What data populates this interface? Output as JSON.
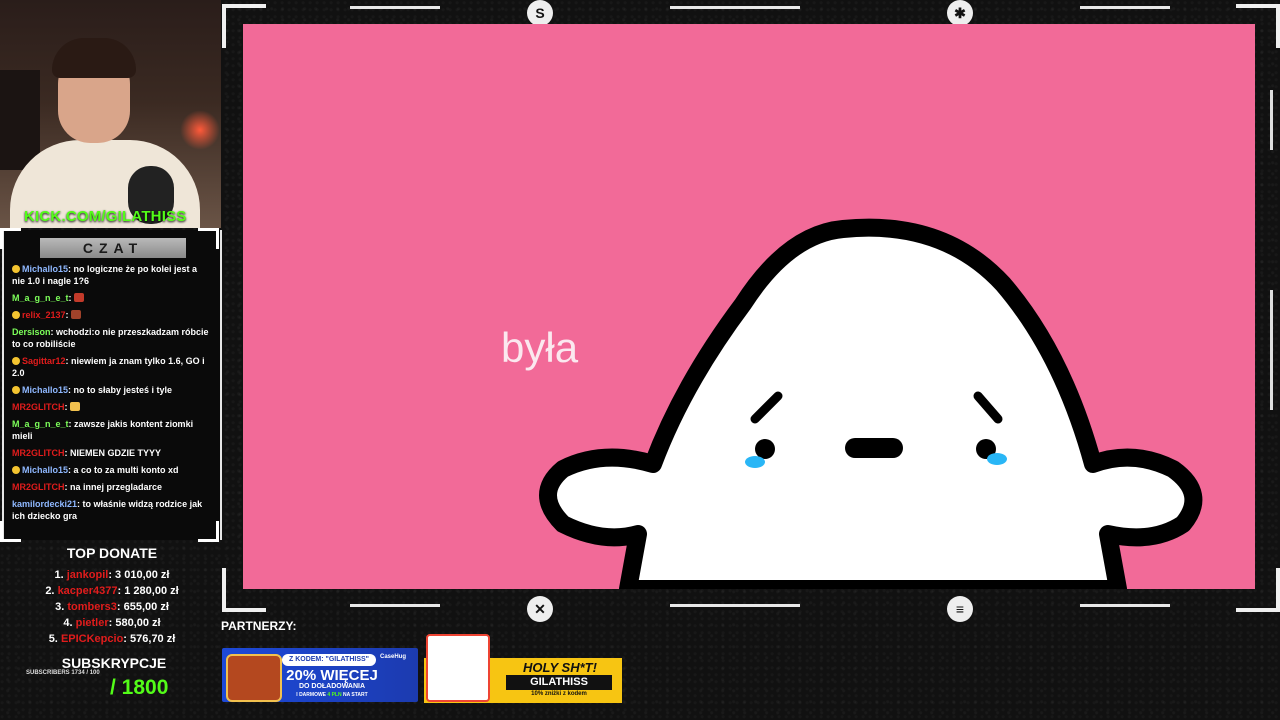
{
  "kick_url": {
    "prefix": "KICK.COM/",
    "handle": "GILATHISS"
  },
  "chat": {
    "title": "CZAT",
    "messages": [
      {
        "user": "Michallo15",
        "color": "#8fb8ff",
        "badge": true,
        "text": "no logiczne że po kolei jest a nie 1.0 i nagle 1?6"
      },
      {
        "user": "M_a_g_n_e_t",
        "color": "#7dff5a",
        "badge": false,
        "text": "",
        "emote": "#c23a2a"
      },
      {
        "user": "relix_2137",
        "color": "#e11c1c",
        "badge": true,
        "text": "",
        "emote": "#a0422a"
      },
      {
        "user": "Dersison",
        "color": "#7dff5a",
        "badge": false,
        "text": "wchodzi:o nie przeszkadzam róbcie to co robiliście"
      },
      {
        "user": "Sagittar12",
        "color": "#e11c1c",
        "badge": true,
        "text": "niewiem ja znam tylko 1.6, GO i 2.0"
      },
      {
        "user": "Michallo15",
        "color": "#8fb8ff",
        "badge": true,
        "text": "no to słaby jesteś i tyle"
      },
      {
        "user": "MR2GLITCH",
        "color": "#e11c1c",
        "badge": false,
        "text": "",
        "emote": "#f2c14e"
      },
      {
        "user": "M_a_g_n_e_t",
        "color": "#7dff5a",
        "badge": false,
        "text": "zawsze jakis kontent ziomki mieli"
      },
      {
        "user": "MR2GLITCH",
        "color": "#e11c1c",
        "badge": false,
        "text": "NIEMEN GDZIE TYYY"
      },
      {
        "user": "Michallo15",
        "color": "#8fb8ff",
        "badge": true,
        "text": "a co to za multi konto xd"
      },
      {
        "user": "MR2GLITCH",
        "color": "#e11c1c",
        "badge": false,
        "text": "na innej przegladarce"
      },
      {
        "user": "kamilordecki21",
        "color": "#8fb8ff",
        "badge": false,
        "text": "to właśnie widzą rodzice jak ich dziecko gra"
      }
    ]
  },
  "top_donate": {
    "title": "TOP DONATE",
    "entries": [
      {
        "rank": "1.",
        "name": "jankopil",
        "amount": "3 010,00 zł"
      },
      {
        "rank": "2.",
        "name": "kacper4377",
        "amount": "1 280,00 zł"
      },
      {
        "rank": "3.",
        "name": "tombers3",
        "amount": "655,00 zł"
      },
      {
        "rank": "4.",
        "name": "pietler",
        "amount": "580,00 zł"
      },
      {
        "rank": "5.",
        "name": "EPICKepcio",
        "amount": "576,70 zł"
      }
    ]
  },
  "subs": {
    "title": "SUBSKRYPCJE",
    "small": "SUBSCRIBERS 1734 / 100",
    "count": "/ 1800"
  },
  "stage": {
    "word": "była",
    "bg": "#f26a98"
  },
  "partners": {
    "label": "PARTNERZY:",
    "banner1": {
      "code": "Z KODEM: \"GILATHISS\"",
      "brand": "CaseHug",
      "big": "20% WIĘCEJ",
      "sub": "DO DOŁADOWANIA",
      "foot_a": "I DARMOWE ",
      "foot_hl": "4 PLN",
      "foot_b": " NA START"
    },
    "banner2": {
      "title": "HOLY SH*T!",
      "code": "GILATHISS",
      "sub": "10% zniżki z kodem"
    }
  }
}
